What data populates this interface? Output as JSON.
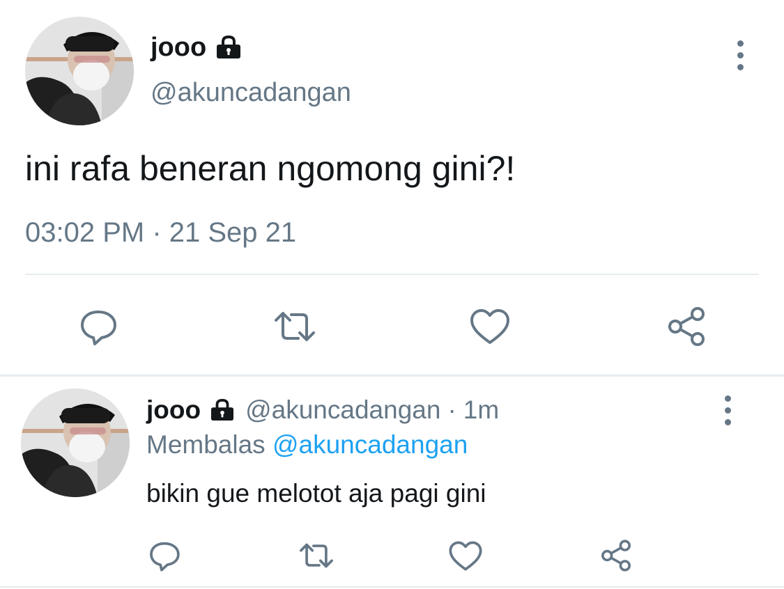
{
  "main_tweet": {
    "display_name": "jooo",
    "handle": "@akuncadangan",
    "text": "ini rafa beneran ngomong gini?!",
    "timestamp": "03:02 PM · 21 Sep 21",
    "locked_icon": "lock-icon",
    "menu_icon": "more-vertical-icon",
    "actions": [
      "reply-icon",
      "retweet-icon",
      "like-icon",
      "share-icon"
    ]
  },
  "reply_tweet": {
    "display_name": "jooo",
    "handle": "@akuncadangan",
    "separator": "·",
    "time_ago": "1m",
    "replying_prefix": "Membalas",
    "replying_to": "@akuncadangan",
    "text": "bikin gue melotot aja pagi gini",
    "locked_icon": "lock-icon",
    "menu_icon": "more-vertical-icon",
    "actions": [
      "reply-icon",
      "retweet-icon",
      "like-icon",
      "share-icon"
    ]
  },
  "colors": {
    "text_primary": "#14171a",
    "text_secondary": "#657786",
    "link": "#1da1f2",
    "divider": "#e6ecf0"
  }
}
